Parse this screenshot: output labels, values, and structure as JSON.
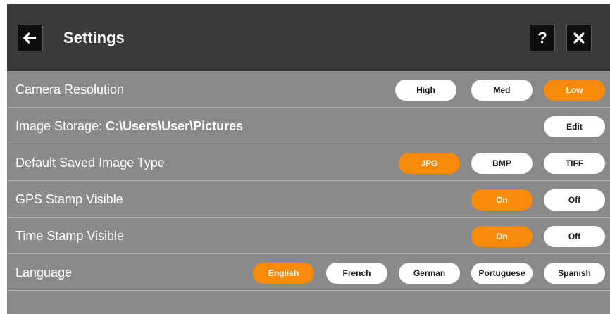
{
  "header": {
    "title": "Settings",
    "help_label": "?"
  },
  "colors": {
    "accent": "#f98a0a",
    "header_bg": "#3a3a3a",
    "panel_bg": "#8a8a8a"
  },
  "rows": {
    "camera": {
      "label": "Camera Resolution",
      "options": [
        "High",
        "Med",
        "Low"
      ],
      "selected": "Low"
    },
    "storage": {
      "label": "Image Storage: ",
      "path": "C:\\Users\\User\\Pictures",
      "edit_label": "Edit"
    },
    "image_type": {
      "label": "Default Saved Image Type",
      "options": [
        "JPG",
        "BMP",
        "TIFF"
      ],
      "selected": "JPG"
    },
    "gps": {
      "label": "GPS Stamp Visible",
      "options": [
        "On",
        "Off"
      ],
      "selected": "On"
    },
    "time": {
      "label": "Time Stamp Visible",
      "options": [
        "On",
        "Off"
      ],
      "selected": "On"
    },
    "language": {
      "label": "Language",
      "options": [
        "English",
        "French",
        "German",
        "Portuguese",
        "Spanish"
      ],
      "selected": "English"
    }
  }
}
